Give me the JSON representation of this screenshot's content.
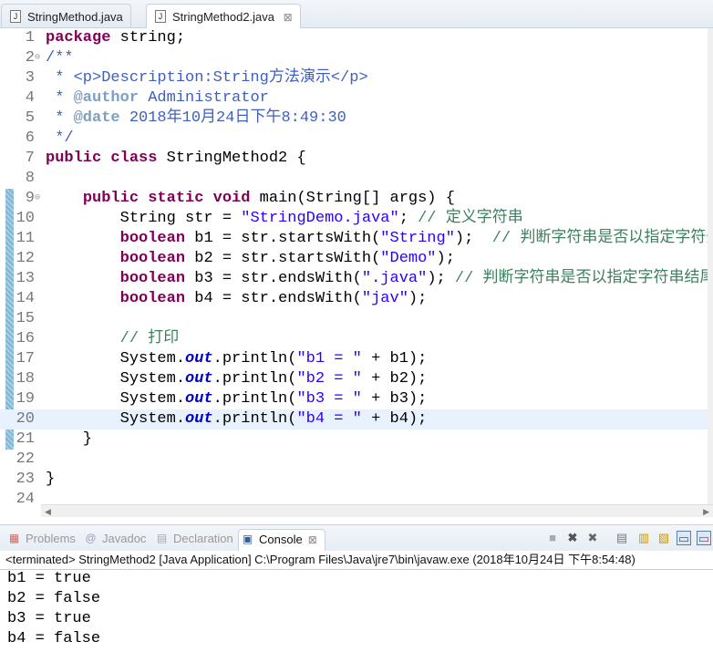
{
  "tabs": [
    {
      "label": "StringMethod.java",
      "active": false
    },
    {
      "label": "StringMethod2.java",
      "active": true,
      "close": "⊠"
    }
  ],
  "code": [
    [
      [
        "k",
        "package"
      ],
      [
        "p",
        " string;"
      ]
    ],
    [
      [
        "d",
        "/**"
      ]
    ],
    [
      [
        "d",
        " * <p>Description:String方法演示</p>"
      ]
    ],
    [
      [
        "d",
        " * "
      ],
      [
        "t",
        "@author"
      ],
      [
        "d",
        " Administrator"
      ]
    ],
    [
      [
        "d",
        " * "
      ],
      [
        "t",
        "@date"
      ],
      [
        "d",
        " 2018年10月24日下午8:49:30"
      ]
    ],
    [
      [
        "d",
        " */"
      ]
    ],
    [
      [
        "k",
        "public"
      ],
      [
        "p",
        " "
      ],
      [
        "k",
        "class"
      ],
      [
        "p",
        " StringMethod2 {"
      ]
    ],
    [],
    [
      [
        "p",
        "    "
      ],
      [
        "k",
        "public"
      ],
      [
        "p",
        " "
      ],
      [
        "k",
        "static"
      ],
      [
        "p",
        " "
      ],
      [
        "k",
        "void"
      ],
      [
        "p",
        " main(String[] args) {"
      ]
    ],
    [
      [
        "p",
        "        String str = "
      ],
      [
        "s",
        "\"StringDemo.java\""
      ],
      [
        "p",
        "; "
      ],
      [
        "c",
        "// 定义字符串"
      ]
    ],
    [
      [
        "p",
        "        "
      ],
      [
        "k",
        "boolean"
      ],
      [
        "p",
        " b1 = str.startsWith("
      ],
      [
        "s",
        "\"String\""
      ],
      [
        "p",
        ");  "
      ],
      [
        "c",
        "// 判断字符串是否以指定字符开头"
      ]
    ],
    [
      [
        "p",
        "        "
      ],
      [
        "k",
        "boolean"
      ],
      [
        "p",
        " b2 = str.startsWith("
      ],
      [
        "s",
        "\"Demo\""
      ],
      [
        "p",
        ");"
      ]
    ],
    [
      [
        "p",
        "        "
      ],
      [
        "k",
        "boolean"
      ],
      [
        "p",
        " b3 = str.endsWith("
      ],
      [
        "s",
        "\".java\""
      ],
      [
        "p",
        "); "
      ],
      [
        "c",
        "// 判断字符串是否以指定字符串结尾"
      ]
    ],
    [
      [
        "p",
        "        "
      ],
      [
        "k",
        "boolean"
      ],
      [
        "p",
        " b4 = str.endsWith("
      ],
      [
        "s",
        "\"jav\""
      ],
      [
        "p",
        ");"
      ]
    ],
    [],
    [
      [
        "p",
        "        "
      ],
      [
        "c",
        "// 打印"
      ]
    ],
    [
      [
        "p",
        "        System."
      ],
      [
        "f",
        "out"
      ],
      [
        "p",
        ".println("
      ],
      [
        "s",
        "\"b1 = \""
      ],
      [
        "p",
        " + b1);"
      ]
    ],
    [
      [
        "p",
        "        System."
      ],
      [
        "f",
        "out"
      ],
      [
        "p",
        ".println("
      ],
      [
        "s",
        "\"b2 = \""
      ],
      [
        "p",
        " + b2);"
      ]
    ],
    [
      [
        "p",
        "        System."
      ],
      [
        "f",
        "out"
      ],
      [
        "p",
        ".println("
      ],
      [
        "s",
        "\"b3 = \""
      ],
      [
        "p",
        " + b3);"
      ]
    ],
    [
      [
        "p",
        "        System."
      ],
      [
        "f",
        "out"
      ],
      [
        "p",
        ".println("
      ],
      [
        "s",
        "\"b4 = \""
      ],
      [
        "p",
        " + b4);"
      ]
    ],
    [
      [
        "p",
        "    }"
      ]
    ],
    [],
    [
      [
        "p",
        "}"
      ]
    ],
    []
  ],
  "current_line": 20,
  "folded_lines": [
    2,
    9
  ],
  "views": {
    "tabs": [
      {
        "label": "Problems",
        "icon": "problems-icon"
      },
      {
        "label": "Javadoc",
        "icon": "@"
      },
      {
        "label": "Declaration",
        "icon": "declaration-icon"
      },
      {
        "label": "Console",
        "icon": "console-icon",
        "active": true
      }
    ],
    "close": "⊠",
    "status": "<terminated> StringMethod2 [Java Application] C:\\Program Files\\Java\\jre7\\bin\\javaw.exe (2018年10月24日 下午8:54:48)",
    "output": [
      "b1 = true",
      "b2 = false",
      "b3 = true",
      "b4 = false"
    ]
  }
}
